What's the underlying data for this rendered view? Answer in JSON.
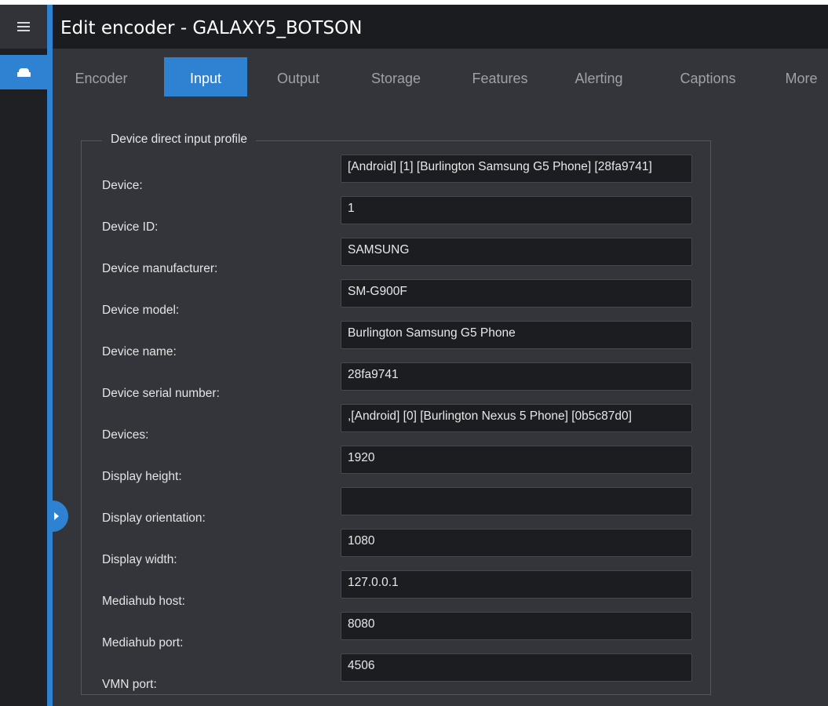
{
  "window": {
    "title": "Edit encoder - GALAXY5_BOTSON"
  },
  "sidebar": {
    "menu_icon": "hamburger-menu-icon",
    "active_icon": "drive-icon",
    "collapse_icon": "chevron-right-icon"
  },
  "tabs": [
    {
      "label": "Encoder",
      "active": false
    },
    {
      "label": "Input",
      "active": true
    },
    {
      "label": "Output",
      "active": false
    },
    {
      "label": "Storage",
      "active": false
    },
    {
      "label": "Features",
      "active": false
    },
    {
      "label": "Alerting",
      "active": false
    },
    {
      "label": "Captions",
      "active": false
    },
    {
      "label": "More",
      "active": false
    }
  ],
  "section": {
    "legend": "Device direct input profile"
  },
  "fields": [
    {
      "label": "Device:",
      "value": "[Android] [1] [Burlington Samsung G5 Phone] [28fa9741]"
    },
    {
      "label": "Device ID:",
      "value": "1"
    },
    {
      "label": "Device manufacturer:",
      "value": "SAMSUNG"
    },
    {
      "label": "Device model:",
      "value": "SM-G900F"
    },
    {
      "label": "Device name:",
      "value": "Burlington Samsung G5 Phone"
    },
    {
      "label": "Device serial number:",
      "value": "28fa9741"
    },
    {
      "label": "Devices:",
      "value": ",[Android] [0] [Burlington Nexus 5 Phone] [0b5c87d0]"
    },
    {
      "label": "Display height:",
      "value": "1920"
    },
    {
      "label": "Display orientation:",
      "value": ""
    },
    {
      "label": "Display width:",
      "value": "1080"
    },
    {
      "label": "Mediahub host:",
      "value": "127.0.0.1"
    },
    {
      "label": "Mediahub port:",
      "value": "8080"
    },
    {
      "label": "VMN port:",
      "value": "4506"
    }
  ],
  "colors": {
    "accent": "#2f82d1",
    "background": "#34353a",
    "header": "#1b1c1f",
    "field_bg": "#1c1d20"
  }
}
